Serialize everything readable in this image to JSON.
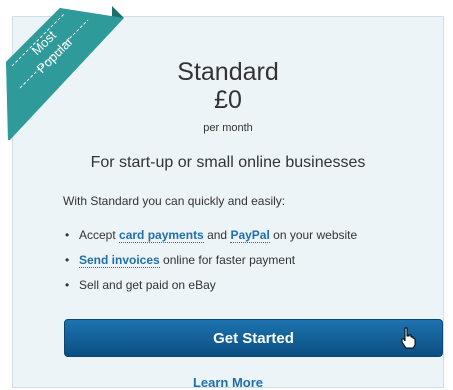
{
  "ribbon": {
    "line1": "Most",
    "line2": "Popular",
    "color": "#2e9a99"
  },
  "plan": {
    "name": "Standard",
    "price": "£0",
    "period": "per month",
    "tagline": "For start-up or small online businesses",
    "intro": "With Standard you can quickly and easily:"
  },
  "features": [
    {
      "prefix": "Accept ",
      "link1": "card payments",
      "mid": " and ",
      "link2": "PayPal",
      "suffix": " on your website"
    },
    {
      "link1": "Send invoices",
      "suffix": " online for faster payment"
    },
    {
      "text": "Sell and get paid on eBay"
    }
  ],
  "actions": {
    "get_started": "Get Started",
    "learn_more": "Learn More"
  },
  "colors": {
    "accent": "#1f6fad",
    "button": "#0b5a93",
    "card_bg": "#edf4f8"
  },
  "icons": [
    "hand-pointer-icon"
  ]
}
